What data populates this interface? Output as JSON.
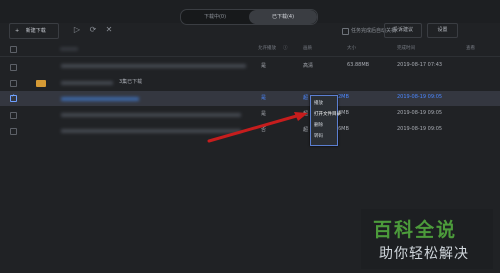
{
  "top_tabs": {
    "downloading": "下载中(0)",
    "downloaded": "已下载(4)"
  },
  "toolbar": {
    "new_download": "新建下载",
    "auto_shutdown": "任务完成后自动关机",
    "feedback": "投诉建议",
    "settings": "设置"
  },
  "table": {
    "headers": {
      "allow_p2p": "允许播放",
      "quality": "画质",
      "size": "大小",
      "completed_time": "完成时间",
      "view": "查看"
    }
  },
  "rows": [
    {
      "p2p": "是",
      "quality": "高清",
      "size": "63.88MB",
      "time": "2019-08-17 07:43"
    },
    {
      "folder_label": "3集已下载"
    },
    {
      "p2p": "是",
      "quality": "超",
      "size": "2MB",
      "time": "2019-08-19 09:05"
    },
    {
      "p2p": "是",
      "quality": "超",
      "size": "3MB",
      "time": "2019-08-19 09:05"
    },
    {
      "p2p": "否",
      "quality": "超",
      "size": "6MB",
      "time": "2019-08-19 09:05"
    }
  ],
  "context_menu": {
    "play": "播放",
    "open_folder": "打开文件目录",
    "delete": "删除",
    "transcode": "转码"
  },
  "watermark": {
    "top": "百科全说",
    "bottom": "助你轻松解决"
  }
}
